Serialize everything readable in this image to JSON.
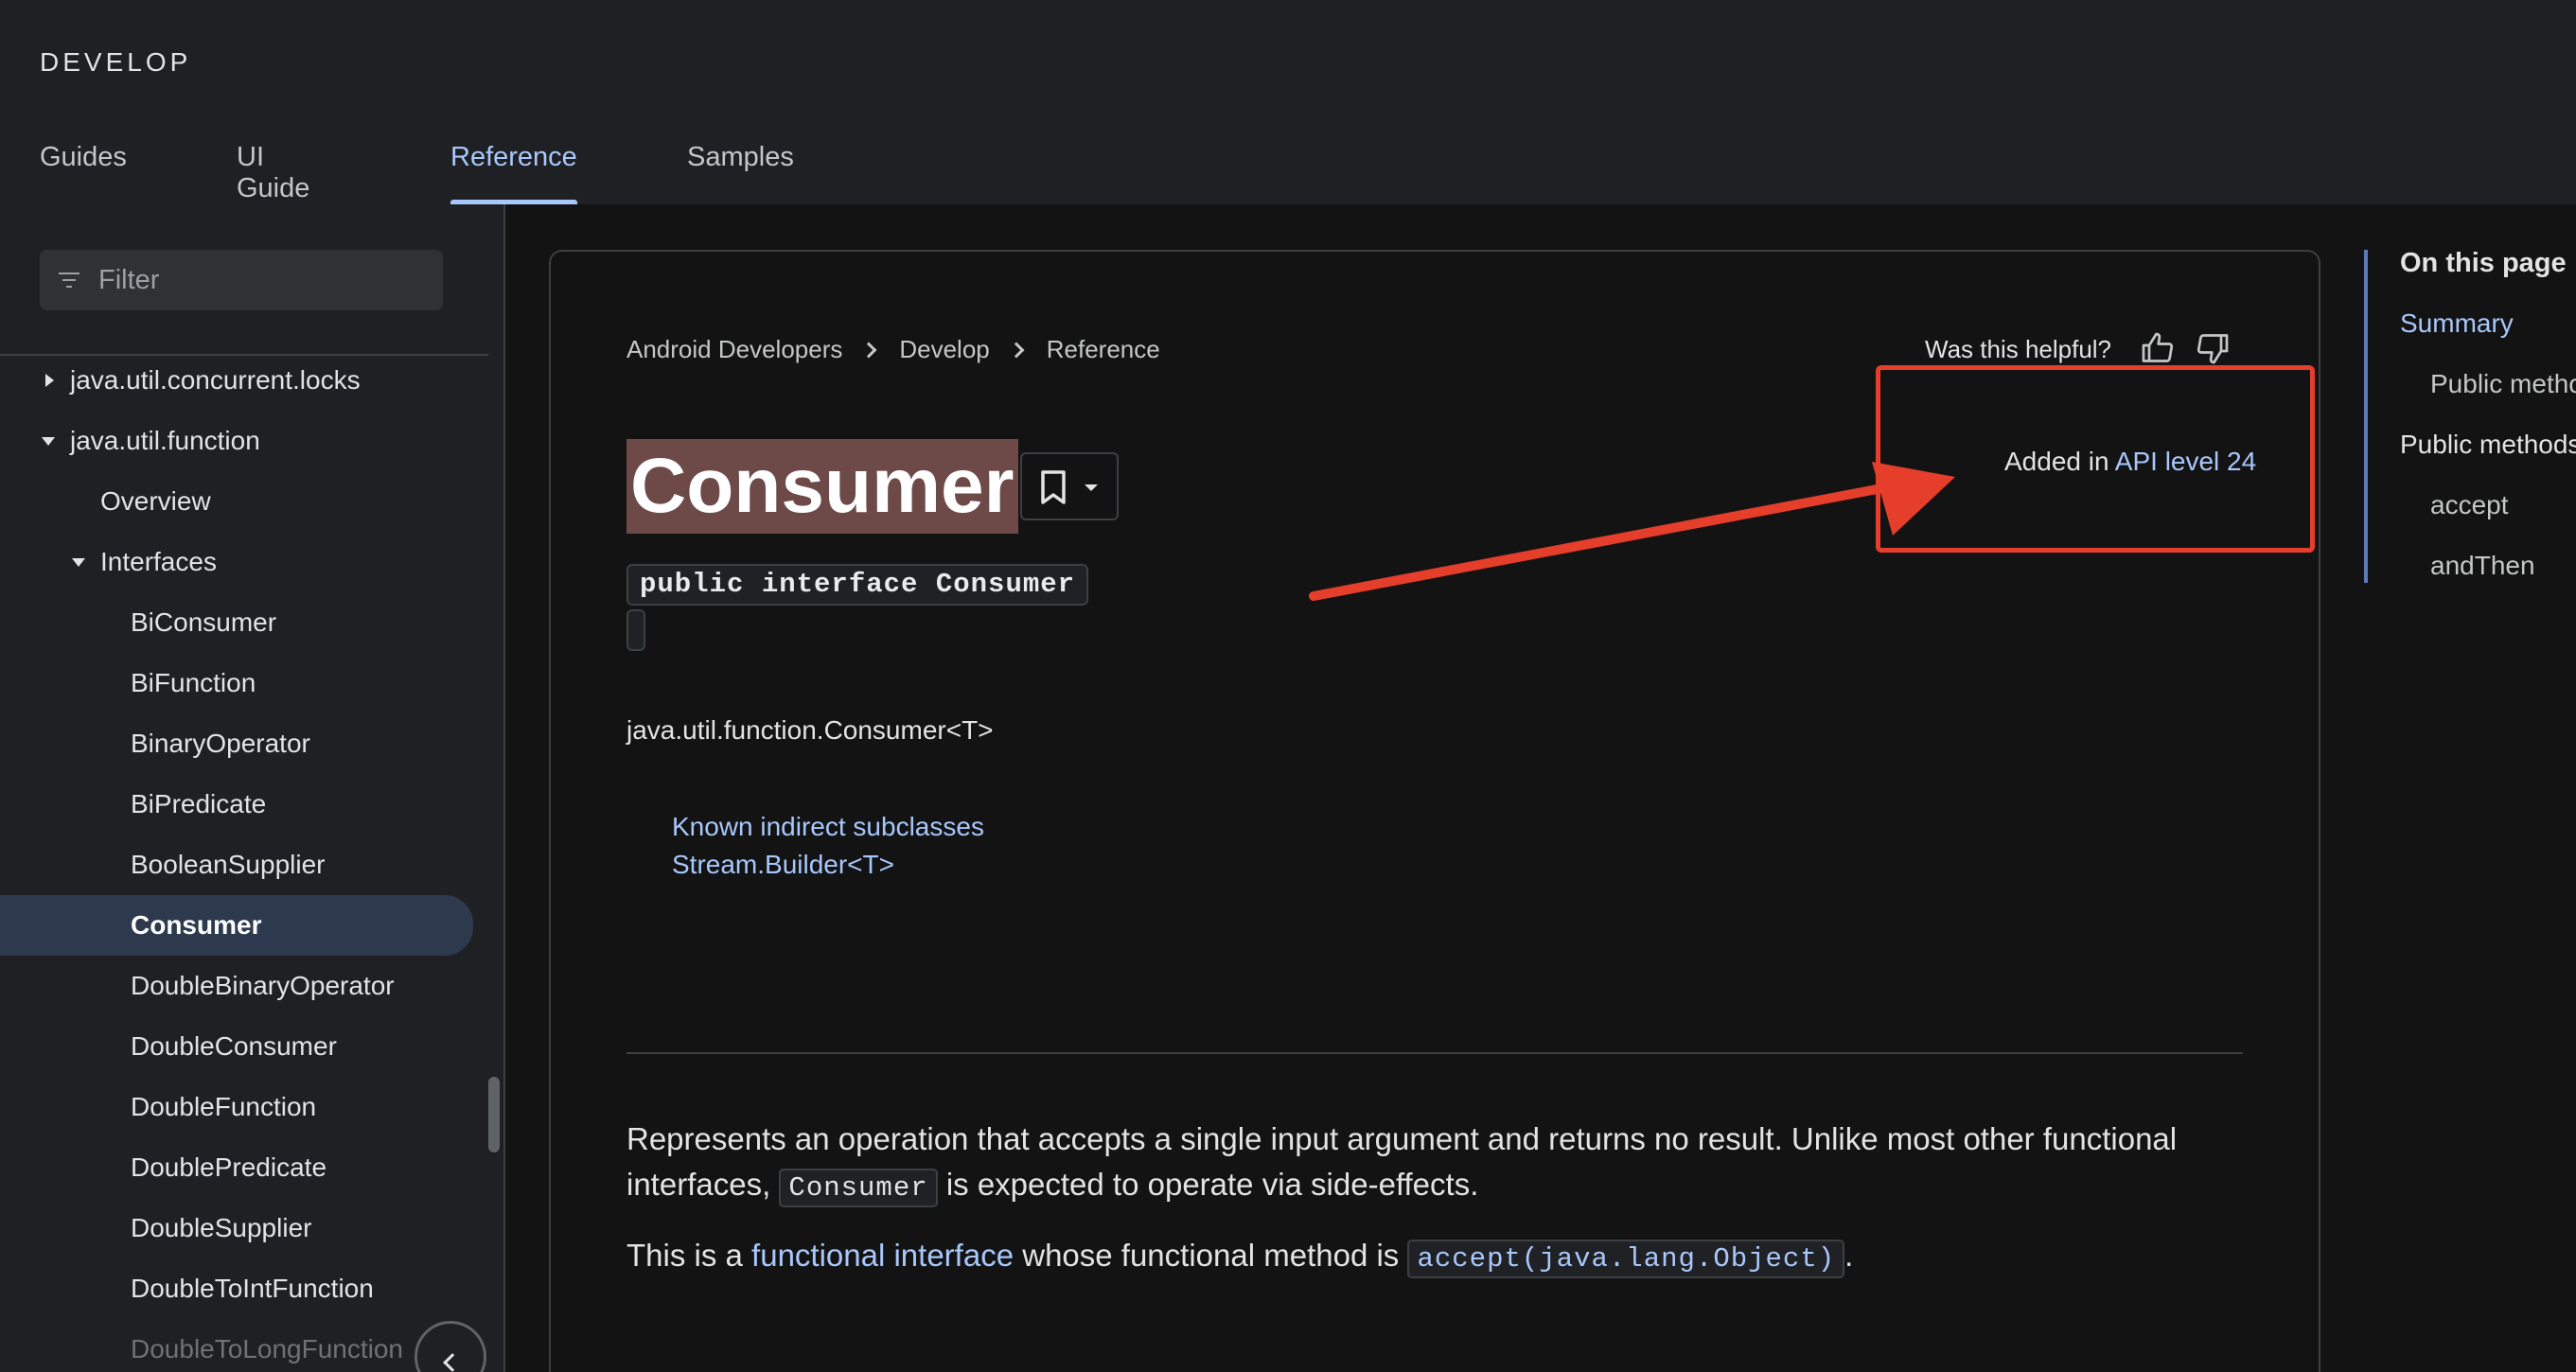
{
  "header": {
    "brand": "DEVELOP",
    "tabs": [
      {
        "label": "Guides"
      },
      {
        "label": "UI Guide"
      },
      {
        "label": "Reference",
        "active": true
      },
      {
        "label": "Samples"
      }
    ]
  },
  "sidebar": {
    "filter_placeholder": "Filter",
    "items": [
      {
        "label": "java.util.concurrent.locks",
        "caret": "right"
      },
      {
        "label": "java.util.function",
        "caret": "down"
      },
      {
        "label": "Overview"
      },
      {
        "label": "Interfaces",
        "caret": "down"
      },
      {
        "label": "BiConsumer"
      },
      {
        "label": "BiFunction"
      },
      {
        "label": "BinaryOperator"
      },
      {
        "label": "BiPredicate"
      },
      {
        "label": "BooleanSupplier"
      },
      {
        "label": "Consumer",
        "selected": true
      },
      {
        "label": "DoubleBinaryOperator"
      },
      {
        "label": "DoubleConsumer"
      },
      {
        "label": "DoubleFunction"
      },
      {
        "label": "DoublePredicate"
      },
      {
        "label": "DoubleSupplier"
      },
      {
        "label": "DoubleToIntFunction"
      },
      {
        "label": "DoubleToLongFunction"
      }
    ]
  },
  "breadcrumb": [
    "Android Developers",
    "Develop",
    "Reference"
  ],
  "helpful": "Was this helpful?",
  "page": {
    "title": "Consumer",
    "declaration": "public interface Consumer",
    "fqname": "java.util.function.Consumer<T>",
    "known_subclasses_label": "Known indirect subclasses",
    "known_subclasses": "Stream.Builder<T>",
    "added_prefix": "Added in ",
    "added_link": "API level 24",
    "desc1_a": "Represents an operation that accepts a single input argument and returns no result. Unlike most other functional interfaces, ",
    "desc1_code": "Consumer",
    "desc1_b": " is expected to operate via side-effects.",
    "desc2_a": "This is a ",
    "desc2_link": "functional interface",
    "desc2_b": " whose functional method is ",
    "desc2_code": "accept(java.lang.Object)",
    "desc2_c": "."
  },
  "toc": {
    "title": "On this page",
    "items": [
      {
        "label": "Summary",
        "level": 1,
        "active": true
      },
      {
        "label": "Public methods",
        "level": 2
      },
      {
        "label": "Public methods",
        "level": 1
      },
      {
        "label": "accept",
        "level": 2
      },
      {
        "label": "andThen",
        "level": 2
      }
    ]
  },
  "colors": {
    "accent": "#a8c7fa",
    "annotation": "#e53e2b",
    "title_highlight": "#6d4a48"
  }
}
